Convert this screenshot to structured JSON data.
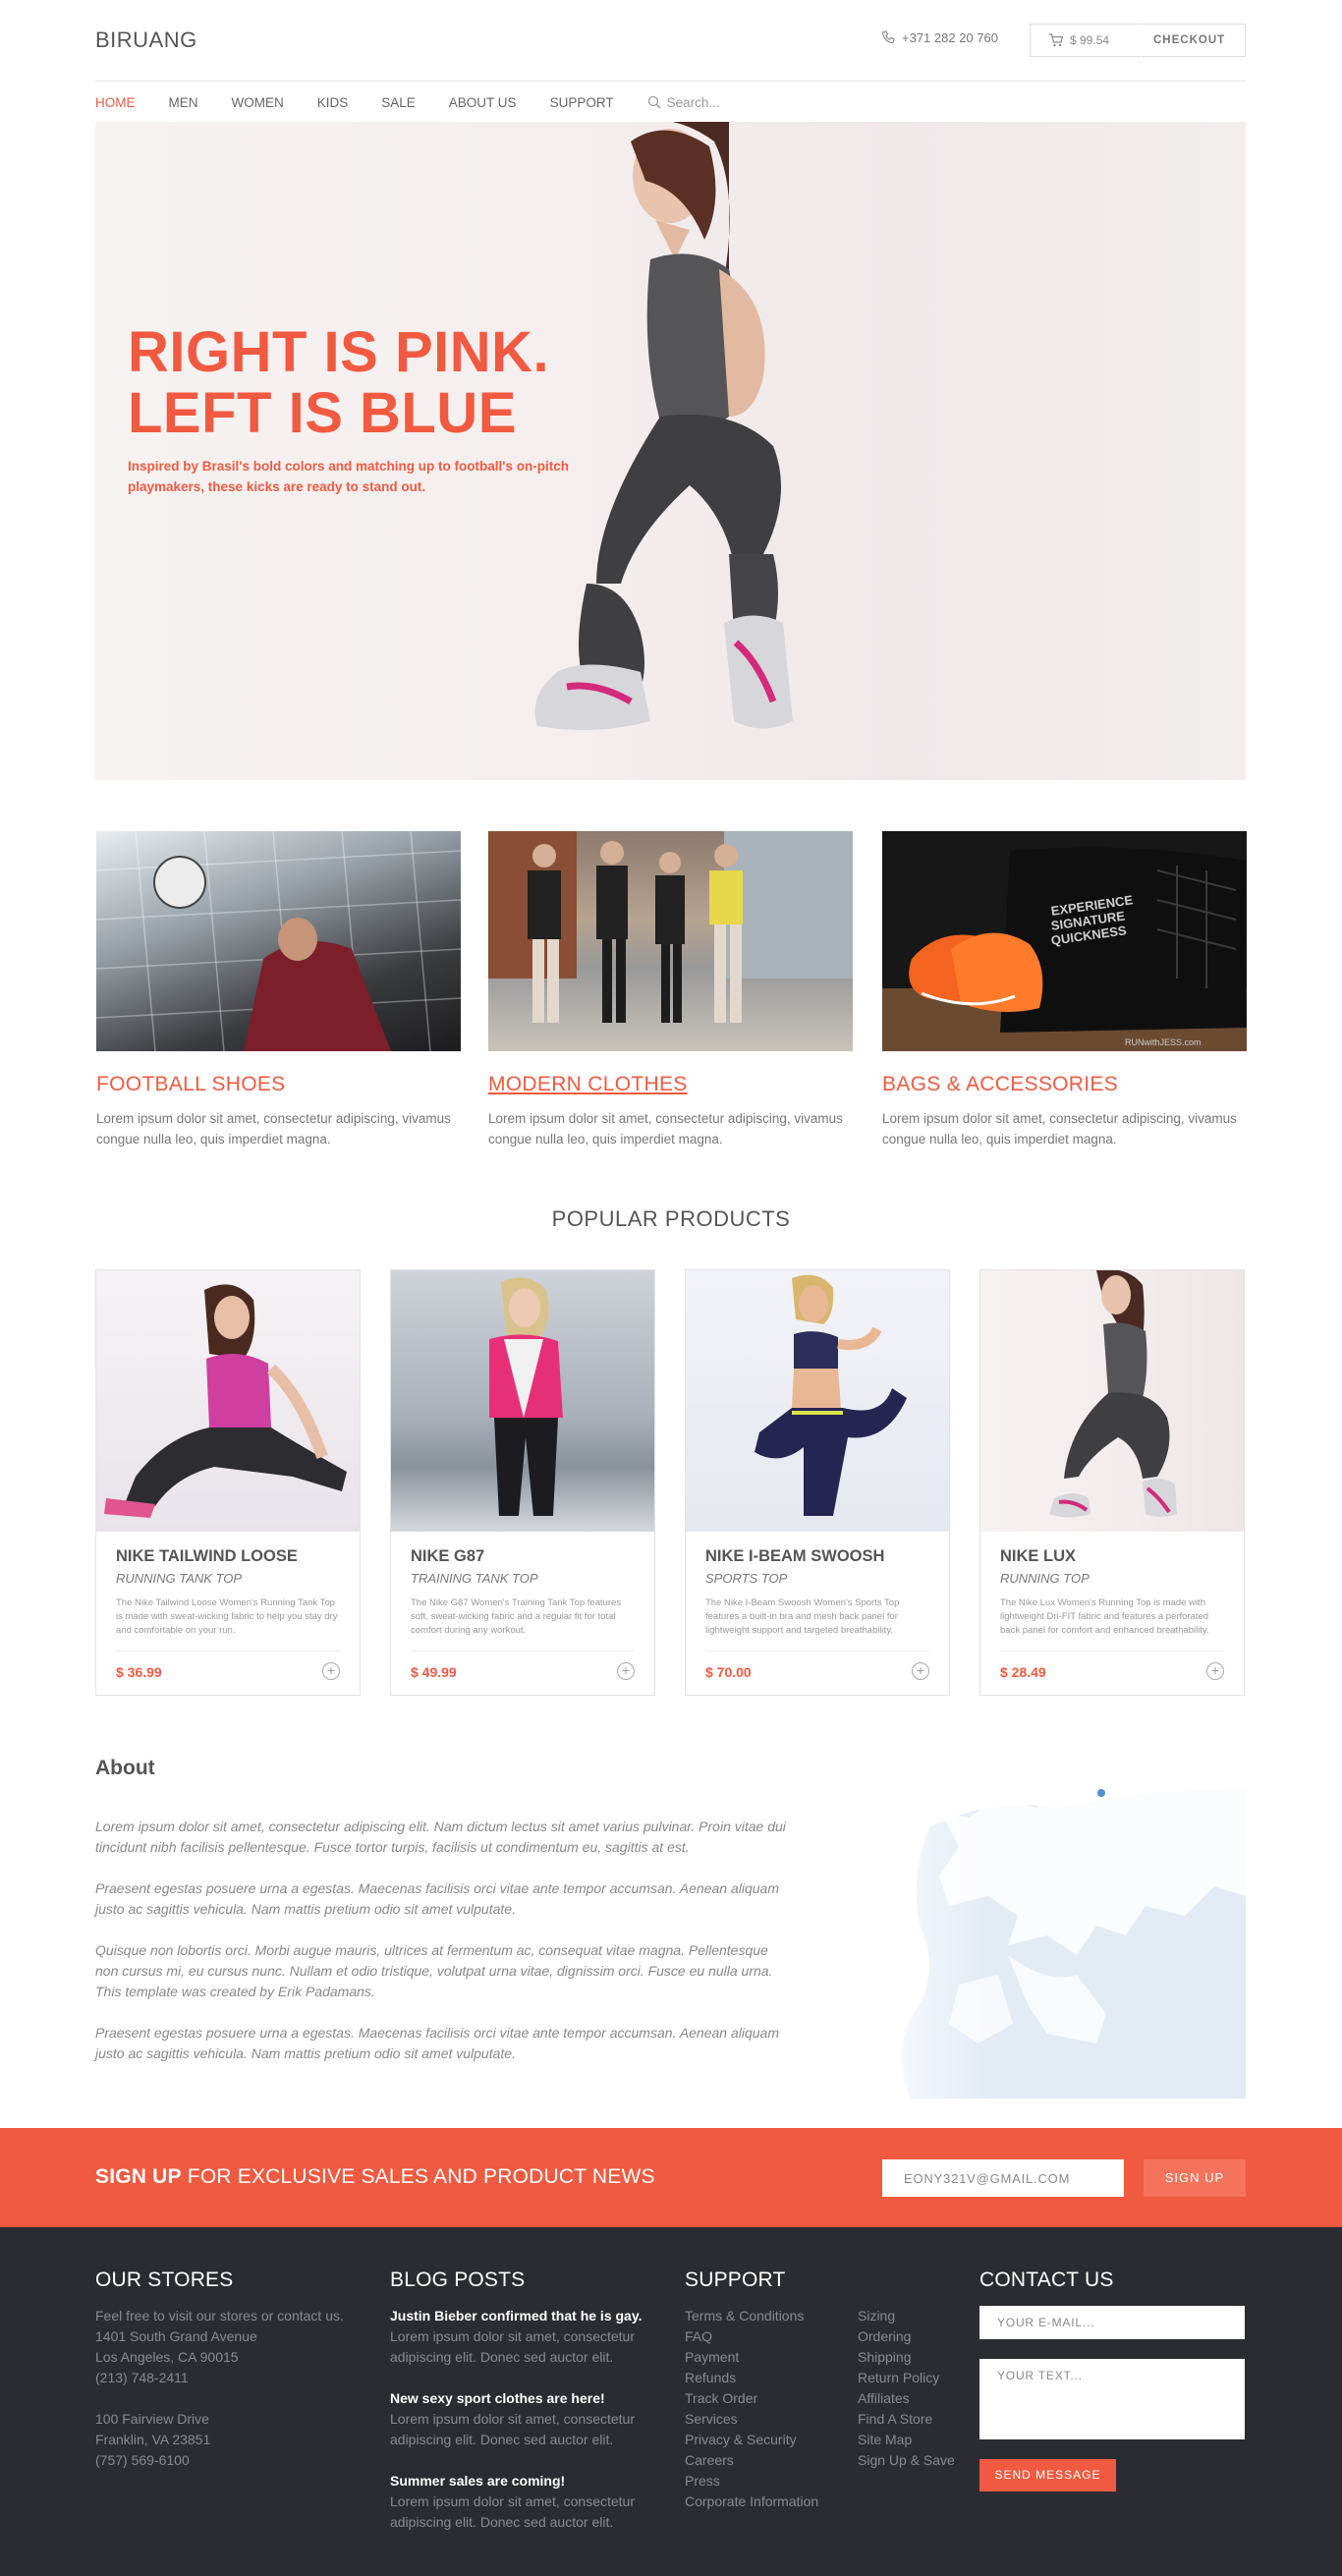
{
  "header": {
    "logo": "BIRUANG",
    "phone": "+371 282 20 760",
    "cart_total": "$ 99.54",
    "checkout": "CHECKOUT"
  },
  "nav": {
    "items": [
      "HOME",
      "MEN",
      "WOMEN",
      "KIDS",
      "SALE",
      "ABOUT US",
      "SUPPORT"
    ],
    "search_placeholder": "Search..."
  },
  "hero": {
    "title_line1": "RIGHT IS PINK.",
    "title_line2": "LEFT IS BLUE",
    "subtitle": "Inspired by Brasil's bold colors and matching up to football's on-pitch playmakers, these kicks are ready to stand out."
  },
  "categories": [
    {
      "title": "FOOTBALL SHOES",
      "desc": "Lorem ipsum dolor sit amet, consectetur adipiscing, vivamus congue nulla leo, quis imperdiet magna."
    },
    {
      "title": "MODERN CLOTHES",
      "desc": "Lorem ipsum dolor sit amet, consectetur adipiscing, vivamus congue nulla leo, quis imperdiet magna."
    },
    {
      "title": "BAGS & ACCESSORIES",
      "desc": "Lorem ipsum dolor sit amet, consectetur adipiscing, vivamus congue nulla leo, quis imperdiet magna."
    }
  ],
  "category_bag_text": [
    "EXPERIENCE",
    "SIGNATURE",
    "QUICKNESS"
  ],
  "category_watermark": "RUNwithJESS.com",
  "popular": {
    "title": "POPULAR PRODUCTS",
    "products": [
      {
        "name": "NIKE TAILWIND LOOSE",
        "type": "RUNNING TANK TOP",
        "desc": "The Nike Tailwind Loose Women's Running Tank Top is made with sweat-wicking fabric to help you stay dry and comfortable on your run.",
        "price": "$ 36.99"
      },
      {
        "name": "NIKE G87",
        "type": "TRAINING TANK TOP",
        "desc": "The Nike G87 Women's Training Tank Top features soft, sweat-wicking fabric and a regular fit for total comfort during any workout.",
        "price": "$ 49.99"
      },
      {
        "name": "NIKE I-BEAM SWOOSH",
        "type": "SPORTS TOP",
        "desc": "The Nike I-Beam Swoosh Women's Sports Top features a built-in bra and mesh back panel for lightweight support and targeted breathability.",
        "price": "$ 70.00"
      },
      {
        "name": "NIKE LUX",
        "type": "RUNNING TOP",
        "desc": "The Nike Lux Women's Running Top is made with lightweight Dri-FIT fabric and features a perforated back panel for comfort and enhanced breathability.",
        "price": "$ 28.49"
      }
    ]
  },
  "about": {
    "title": "About",
    "paragraphs": [
      "Lorem ipsum dolor sit amet, consectetur adipiscing elit. Nam dictum lectus sit amet varius pulvinar. Proin vitae dui tincidunt nibh facilisis pellentesque.  Fusce tortor turpis, facilisis ut condimentum eu, sagittis at est.",
      "Praesent egestas posuere urna a egestas. Maecenas facilisis orci vitae ante  tempor accumsan. Aenean aliquam justo ac sagittis vehicula. Nam mattis pretium odio sit amet vulputate.",
      "Quisque non lobortis orci. Morbi augue mauris, ultrices at fermentum ac, consequat vitae magna. Pellentesque non cursus mi, eu cursus nunc. Nullam  et odio tristique, volutpat urna vitae, dignissim orci. Fusce eu nulla urna. This template was created by Erik Padamans.",
      "Praesent egestas posuere urna a egestas. Maecenas facilisis orci vitae ante  tempor accumsan. Aenean aliquam justo ac sagittis vehicula. Nam mattis pretium odio sit amet vulputate."
    ]
  },
  "signup": {
    "bold": "SIGN UP",
    "rest": "FOR EXCLUSIVE SALES AND PRODUCT NEWS",
    "email_value": "EONY321V@GMAIL.COM",
    "button": "SIGN UP"
  },
  "footer": {
    "stores": {
      "title": "OUR STORES",
      "lines1": [
        "Feel free to visit our stores or contact us.",
        "1401 South Grand Avenue",
        "Los Angeles, CA 90015",
        "(213) 748-2411"
      ],
      "lines2": [
        "100 Fairview Drive",
        "Franklin, VA 23851",
        "(757) 569-6100"
      ]
    },
    "blog": {
      "title": "BLOG POSTS",
      "posts": [
        {
          "title": "Justin Bieber confirmed that he is gay.",
          "text": "Lorem ipsum dolor sit amet, consectetur adipiscing elit. Donec sed auctor elit."
        },
        {
          "title": "New sexy sport clothes are here!",
          "text": "Lorem ipsum dolor sit amet, consectetur adipiscing elit. Donec sed auctor elit."
        },
        {
          "title": "Summer sales are coming!",
          "text": "Lorem ipsum dolor sit amet, consectetur adipiscing elit. Donec sed auctor elit."
        }
      ]
    },
    "support": {
      "title": "SUPPORT",
      "col1": [
        "Terms & Conditions",
        "FAQ",
        "Payment",
        "Refunds",
        "Track Order",
        "Services",
        "Privacy & Security",
        "Careers",
        "Press",
        "Corporate Information"
      ],
      "col2": [
        "Sizing",
        "Ordering",
        "Shipping",
        "Return Policy",
        "Affiliates",
        "Find A Store",
        "Site Map",
        "Sign Up & Save"
      ]
    },
    "contact": {
      "title": "CONTACT US",
      "email_placeholder": "YOUR E-MAIL...",
      "text_placeholder": "YOUR TEXT...",
      "button": "SEND MESSAGE"
    }
  },
  "colors": {
    "accent": "#f15a40",
    "footer_bg": "#2b2c31",
    "signup_bg": "#f05a40"
  }
}
